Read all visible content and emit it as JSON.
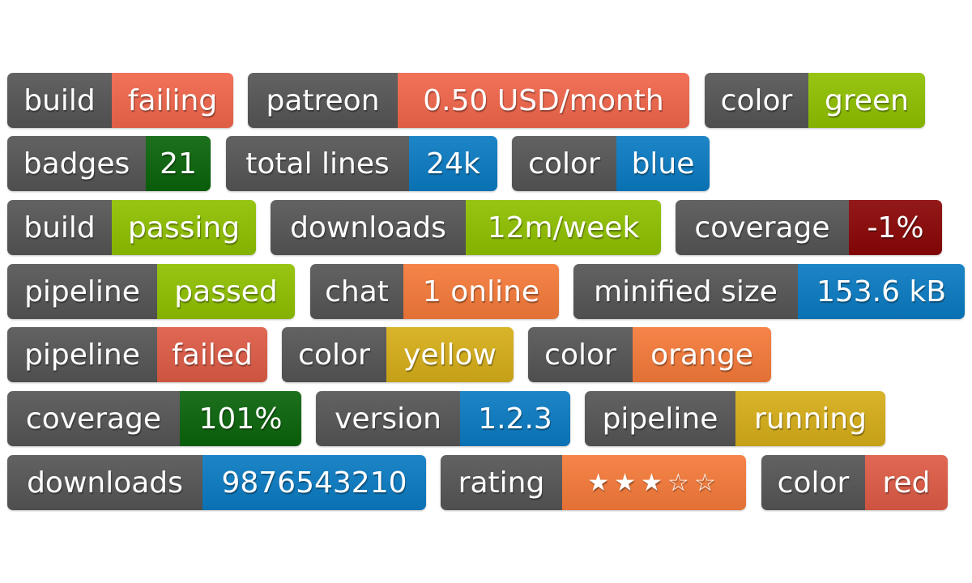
{
  "badges": [
    {
      "label": "build",
      "message": "failing",
      "color": "#f0654b"
    },
    {
      "label": "patreon",
      "message": "0.50 USD/month",
      "color": "#f0654b"
    },
    {
      "label": "color",
      "message": "green",
      "color": "#8fc000"
    },
    {
      "label": "badges",
      "message": "21",
      "color": "#0a640a"
    },
    {
      "label": "total lines",
      "message": "24k",
      "color": "#0a7bc2"
    },
    {
      "label": "color",
      "message": "blue",
      "color": "#0a7bc2"
    },
    {
      "label": "build",
      "message": "passing",
      "color": "#8fc000"
    },
    {
      "label": "downloads",
      "message": "12m/week",
      "color": "#8fc000"
    },
    {
      "label": "coverage",
      "message": "-1%",
      "color": "#8a0606"
    },
    {
      "label": "pipeline",
      "message": "passed",
      "color": "#8fc000"
    },
    {
      "label": "chat",
      "message": "1 online",
      "color": "#f57a3a"
    },
    {
      "label": "minified size",
      "message": "153.6 kB",
      "color": "#0a7bc2"
    },
    {
      "label": "pipeline",
      "message": "failed",
      "color": "#dd5b45"
    },
    {
      "label": "color",
      "message": "yellow",
      "color": "#d6ae18"
    },
    {
      "label": "color",
      "message": "orange",
      "color": "#f57a3a"
    },
    {
      "label": "coverage",
      "message": "101%",
      "color": "#0a640a"
    },
    {
      "label": "version",
      "message": "1.2.3",
      "color": "#0a7bc2"
    },
    {
      "label": "pipeline",
      "message": "running",
      "color": "#d6ae18"
    },
    {
      "label": "downloads",
      "message": "9876543210",
      "color": "#0a7bc2"
    },
    {
      "label": "rating",
      "message": "★★★☆☆",
      "color": "#f57a3a",
      "rating": 3,
      "rating_max": 5
    },
    {
      "label": "color",
      "message": "red",
      "color": "#dd5b45"
    }
  ],
  "label_color": "#555555"
}
